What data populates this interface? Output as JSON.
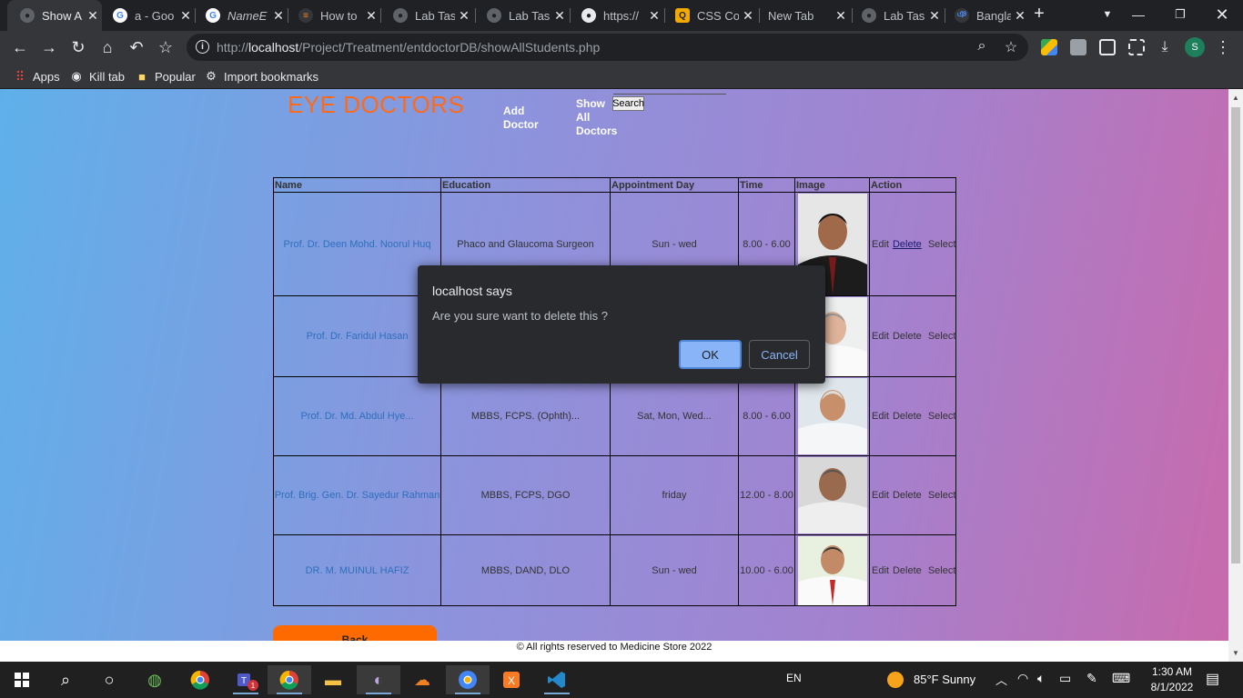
{
  "browser": {
    "tabs": [
      {
        "title": "Show A",
        "fav": "globe-icon",
        "active": true
      },
      {
        "title": "a - Goo",
        "fav": "google-icon"
      },
      {
        "title": "NameE",
        "fav": "google-icon"
      },
      {
        "title": "How to",
        "fav": "stackoverflow-icon"
      },
      {
        "title": "Lab Tas",
        "fav": "globe-icon"
      },
      {
        "title": "Lab Tas",
        "fav": "globe-icon"
      },
      {
        "title": "https://",
        "fav": "globe-icon"
      },
      {
        "title": "CSS Co",
        "fav": "css-icon"
      },
      {
        "title": "New Tab",
        "fav": ""
      },
      {
        "title": "Lab Tas",
        "fav": "globe-icon"
      },
      {
        "title": "Banglac",
        "fav": "bangla-icon"
      }
    ],
    "url_host": "localhost",
    "url_prefix": "http://",
    "url_path": "/Project/Treatment/entdoctorDB/showAllStudents.php",
    "bookmarks": [
      "Apps",
      "Kill tab",
      "Popular",
      "Import bookmarks"
    ],
    "profile_initial": "S",
    "download_count": "1"
  },
  "page": {
    "brand": "EYE DOCTORS",
    "nav_add_doctor": "Add Doctor",
    "nav_show_all": "Show All Doctors",
    "search_label": "Search",
    "columns": [
      "Name",
      "Education",
      "Appointment Day",
      "Time",
      "Image",
      "Action"
    ],
    "rows": [
      {
        "name": "Prof. Dr. Deen Mohd. Noorul Huq",
        "education": "Phaco and Glaucoma Surgeon",
        "day": "Sun - wed",
        "time": "8.00 - 6.00"
      },
      {
        "name": "Prof. Dr. Faridul Hasan",
        "education": "",
        "day": "",
        "time": ""
      },
      {
        "name": "Prof. Dr. Md. Abdul Hye...",
        "education": "MBBS, FCPS. (Ophth)...",
        "day": "Sat, Mon, Wed...",
        "time": "8.00 - 6.00"
      },
      {
        "name": "Prof. Brig. Gen. Dr. Sayedur Rahman",
        "education": "MBBS, FCPS, DGO",
        "day": "friday",
        "time": "12.00 - 8.00"
      },
      {
        "name": "DR. M. MUINUL HAFIZ",
        "education": "MBBS, DAND, DLO",
        "day": "Sun - wed",
        "time": "10.00 - 6.00"
      }
    ],
    "actions": {
      "edit": "Edit",
      "delete": "Delete",
      "select": "Select"
    },
    "back_label": "Back",
    "footer": "© All rights reserved to Medicine Store 2022"
  },
  "dialog": {
    "title": "localhost says",
    "message": "Are you sure want to delete this ?",
    "ok": "OK",
    "cancel": "Cancel"
  },
  "taskbar": {
    "lang": "EN",
    "weather": "85°F  Sunny",
    "time": "1:30 AM",
    "date": "8/1/2022",
    "teams_badge": "1"
  }
}
